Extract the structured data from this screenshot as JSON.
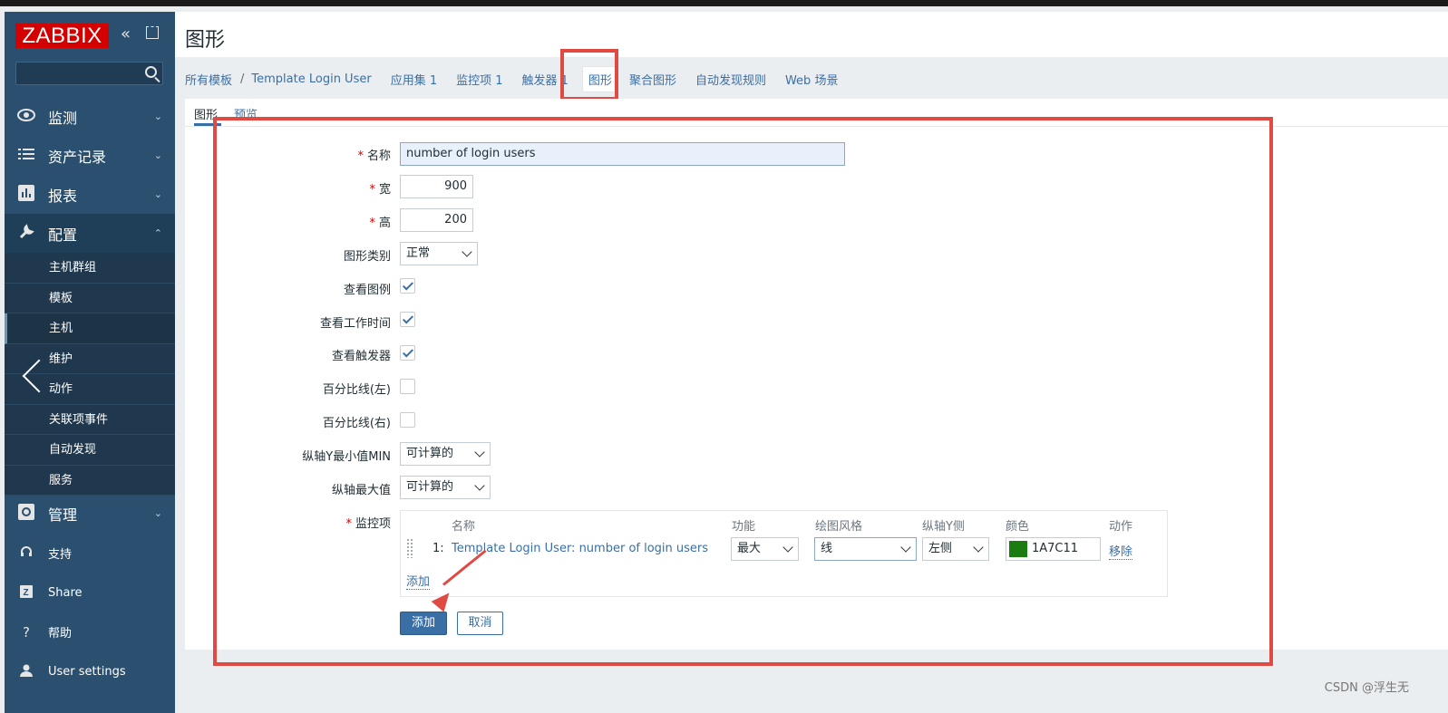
{
  "sidebar": {
    "logo": "ZABBIX",
    "collapse_glyph": "«",
    "search_placeholder": "",
    "menu": [
      {
        "label": "监测",
        "icon": "eye-icon"
      },
      {
        "label": "资产记录",
        "icon": "list-icon"
      },
      {
        "label": "报表",
        "icon": "bar-chart-icon"
      },
      {
        "label": "配置",
        "icon": "wrench-icon"
      }
    ],
    "submenu": [
      "主机群组",
      "模板",
      "主机",
      "维护",
      "动作",
      "关联项事件",
      "自动发现",
      "服务"
    ],
    "admin": {
      "label": "管理",
      "icon": "gear-icon"
    },
    "bottom": [
      {
        "label": "支持",
        "icon": "headset-icon"
      },
      {
        "label": "Share",
        "icon": "share-icon"
      },
      {
        "label": "帮助",
        "icon": "help-icon"
      },
      {
        "label": "User settings",
        "icon": "user-icon"
      }
    ]
  },
  "header": {
    "title": "图形"
  },
  "breadcrumb": {
    "all_templates": "所有模板",
    "separator": "/",
    "template": "Template Login User",
    "apps": "应用集 1",
    "items": "监控项 1",
    "triggers": "触发器 1",
    "graphs": "图形",
    "screens": "聚合图形",
    "discovery": "自动发现规则",
    "web": "Web 场景"
  },
  "tabs": {
    "graph": "图形",
    "preview": "预览"
  },
  "form": {
    "required_mark": "*",
    "name_label": "名称",
    "name_value": "number of login users",
    "width_label": "宽",
    "width_value": "900",
    "height_label": "高",
    "height_value": "200",
    "type_label": "图形类别",
    "type_value": "正常",
    "show_legend_label": "查看图例",
    "show_legend": true,
    "show_work_label": "查看工作时间",
    "show_work": true,
    "show_triggers_label": "查看触发器",
    "show_triggers": true,
    "pct_left_label": "百分比线(左)",
    "pct_left": false,
    "pct_right_label": "百分比线(右)",
    "pct_right": false,
    "ymin_label": "纵轴Y最小值MIN",
    "ymin_value": "可计算的",
    "ymax_label": "纵轴最大值",
    "ymax_value": "可计算的",
    "items_label": "监控项"
  },
  "items_table": {
    "headers": {
      "name": "名称",
      "function": "功能",
      "style": "绘图风格",
      "axis": "纵轴Y侧",
      "color": "颜色",
      "action": "动作"
    },
    "rows": [
      {
        "index": "1:",
        "name": "Template Login User: number of login users",
        "function": "最大",
        "style": "线",
        "axis": "左侧",
        "color": "1A7C11",
        "action": "移除"
      }
    ],
    "add_link": "添加"
  },
  "buttons": {
    "add": "添加",
    "cancel": "取消"
  },
  "watermark": "CSDN @浮生无",
  "colors": {
    "accent": "#3a6fa6",
    "highlight": "#e04a43",
    "item_color": "#1A7C11",
    "sidebar": "#2b4f6e"
  }
}
